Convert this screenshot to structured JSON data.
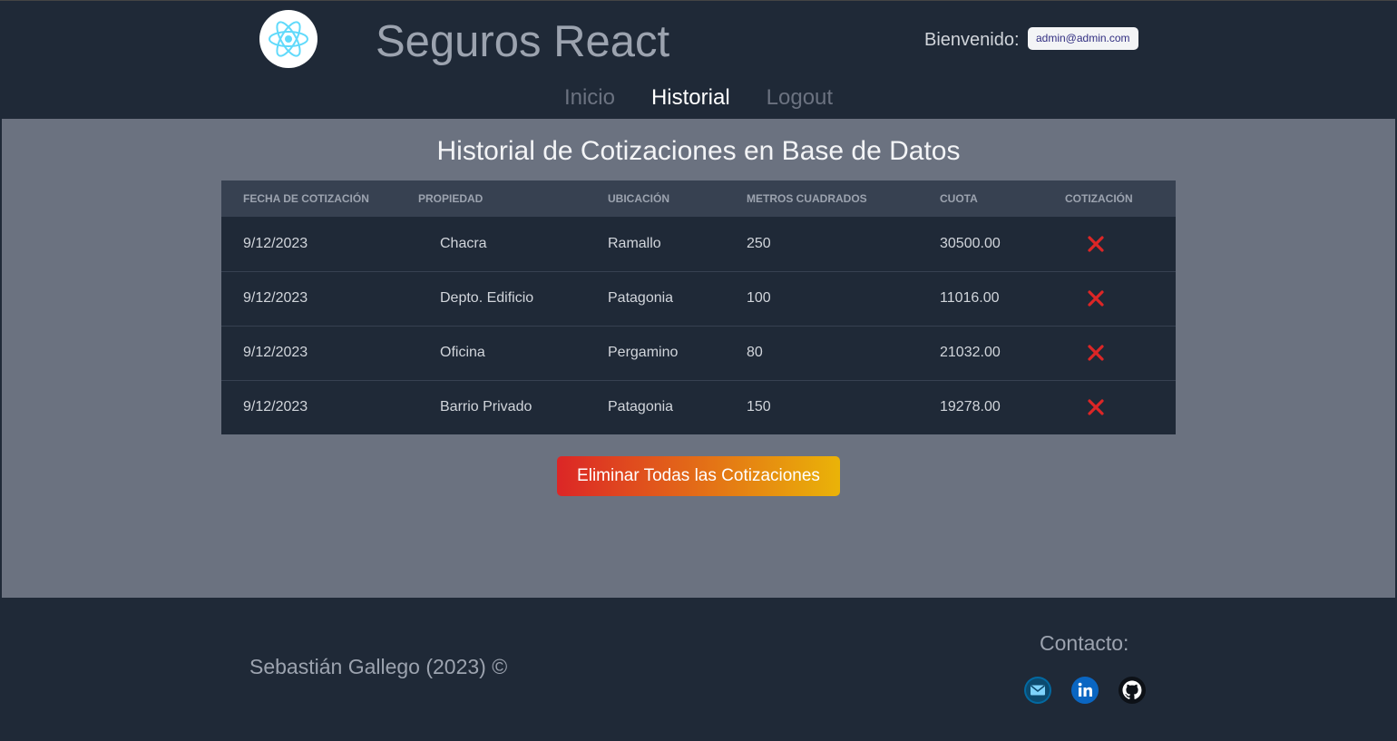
{
  "header": {
    "app_title": "Seguros React",
    "welcome_label": "Bienvenido:",
    "user_email": "admin@admin.com",
    "nav": [
      {
        "label": "Inicio",
        "active": false
      },
      {
        "label": "Historial",
        "active": true
      },
      {
        "label": "Logout",
        "active": false
      }
    ]
  },
  "main": {
    "page_title": "Historial de Cotizaciones en Base de Datos",
    "table": {
      "columns": [
        "Fecha de Cotización",
        "Propiedad",
        "Ubicación",
        "Metros Cuadrados",
        "Cuota",
        "Cotización"
      ],
      "rows": [
        {
          "fecha": "9/12/2023",
          "propiedad": "Chacra",
          "ubicacion": "Ramallo",
          "metros": "250",
          "cuota": "30500.00"
        },
        {
          "fecha": "9/12/2023",
          "propiedad": "Depto. Edificio",
          "ubicacion": "Patagonia",
          "metros": "100",
          "cuota": "11016.00"
        },
        {
          "fecha": "9/12/2023",
          "propiedad": "Oficina",
          "ubicacion": "Pergamino",
          "metros": "80",
          "cuota": "21032.00"
        },
        {
          "fecha": "9/12/2023",
          "propiedad": "Barrio Privado",
          "ubicacion": "Patagonia",
          "metros": "150",
          "cuota": "19278.00"
        }
      ],
      "row_action_icon": "delete-x-icon"
    },
    "delete_all_label": "Eliminar Todas las Cotizaciones"
  },
  "footer": {
    "credit": "Sebastián Gallego (2023) ©",
    "contact_title": "Contacto:",
    "social_icons": [
      "email-icon",
      "linkedin-icon",
      "github-icon"
    ]
  },
  "colors": {
    "header_bg": "#1f2937",
    "main_bg": "#6b7280",
    "table_head_bg": "#374151",
    "delete_icon": "#dc2626",
    "button_gradient_start": "#dc2626",
    "button_gradient_end": "#eab308"
  }
}
